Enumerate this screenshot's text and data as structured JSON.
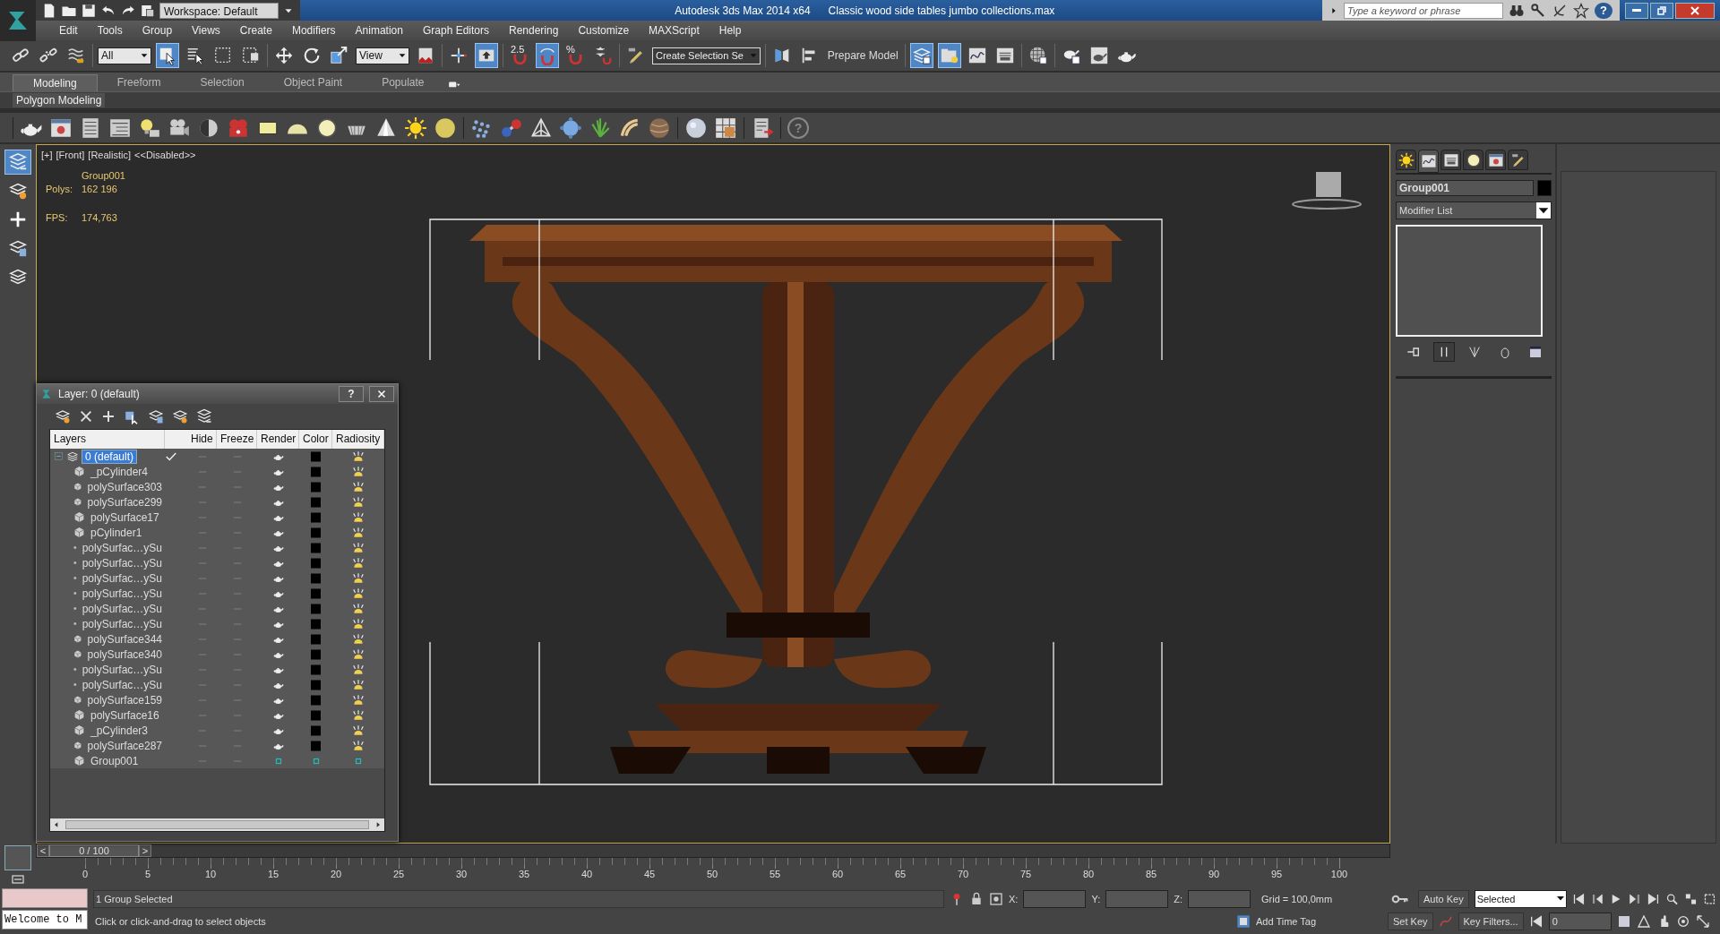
{
  "title_bar": {
    "workspace": "Workspace: Default",
    "app_title": "Autodesk 3ds Max  2014 x64",
    "file_name": "Classic wood side tables  jumbo collections.max",
    "search": {
      "placeholder": "Type a keyword or phrase"
    },
    "help": "?"
  },
  "menu": [
    "Edit",
    "Tools",
    "Group",
    "Views",
    "Create",
    "Modifiers",
    "Animation",
    "Graph Editors",
    "Rendering",
    "Customize",
    "MAXScript",
    "Help"
  ],
  "main_toolbar": [
    {
      "kind": "tool",
      "active": false
    },
    {
      "kind": "tool",
      "active": false
    },
    {
      "kind": "tool",
      "active": false
    },
    {
      "kind": "sep"
    },
    {
      "kind": "dropdown",
      "value": "All"
    },
    {
      "kind": "tool",
      "active": true
    },
    {
      "kind": "tool",
      "active": false
    },
    {
      "kind": "tool",
      "active": false
    },
    {
      "kind": "tool",
      "active": false
    },
    {
      "kind": "sep"
    },
    {
      "kind": "tool",
      "active": false
    },
    {
      "kind": "tool",
      "active": false
    },
    {
      "kind": "tool",
      "active": false
    },
    {
      "kind": "dropdown",
      "value": "View"
    },
    {
      "kind": "tool",
      "active": false
    },
    {
      "kind": "sep"
    },
    {
      "kind": "tool",
      "active": false
    },
    {
      "kind": "tool",
      "active": true
    },
    {
      "kind": "sep"
    },
    {
      "kind": "tool",
      "active": false,
      "text": "2.5"
    },
    {
      "kind": "tool",
      "active": true
    },
    {
      "kind": "tool",
      "active": false,
      "text": "%"
    },
    {
      "kind": "tool",
      "active": false
    },
    {
      "kind": "sep"
    },
    {
      "kind": "tool",
      "active": false
    },
    {
      "kind": "dropdown",
      "value": "Create Selection Se"
    },
    {
      "kind": "sep"
    },
    {
      "kind": "tool",
      "active": false
    },
    {
      "kind": "tool",
      "active": false
    },
    {
      "kind": "button",
      "label": "Prepare Model"
    },
    {
      "kind": "sep"
    },
    {
      "kind": "tool",
      "active": true
    },
    {
      "kind": "tool",
      "active": true
    },
    {
      "kind": "tool",
      "active": false
    },
    {
      "kind": "tool",
      "active": false
    },
    {
      "kind": "sep"
    },
    {
      "kind": "tool",
      "active": false
    },
    {
      "kind": "sep"
    },
    {
      "kind": "tool",
      "active": false
    },
    {
      "kind": "tool",
      "active": false
    },
    {
      "kind": "tool",
      "active": false
    }
  ],
  "ribbon": {
    "tabs": [
      {
        "label": "Modeling",
        "selected": true
      },
      {
        "label": "Freeform",
        "selected": false
      },
      {
        "label": "Selection",
        "selected": false
      },
      {
        "label": "Object Paint",
        "selected": false
      },
      {
        "label": "Populate",
        "selected": false
      }
    ],
    "panel": "Polygon Modeling"
  },
  "object_toolbar": {
    "help": "?"
  },
  "left_tools": [
    {
      "active": true
    },
    {
      "active": false
    },
    {
      "active": false
    },
    {
      "active": false
    },
    {
      "active": false
    }
  ],
  "viewport": {
    "label_parts": [
      "[+]",
      "[Front]",
      "[Realistic]",
      "<<Disabled>>"
    ],
    "stats": {
      "object": "Group001",
      "polys_label": "Polys:",
      "polys": "162 196",
      "fps_label": "FPS:",
      "fps": "174,763"
    },
    "scene": {
      "kind": "picture"
    }
  },
  "layer_dialog": {
    "title": "Layer: 0 (default)",
    "help": "?",
    "columns": [
      "Layers",
      "Hide",
      "Freeze",
      "Render",
      "Color",
      "Radiosity"
    ],
    "layers": [
      {
        "name": "0 (default)",
        "selected": true,
        "current": true,
        "expanded": true,
        "children": [
          {
            "name": "_pCylinder4",
            "by_layer": false
          },
          {
            "name": "polySurface303",
            "by_layer": false
          },
          {
            "name": "polySurface299",
            "by_layer": false
          },
          {
            "name": "polySurface17",
            "by_layer": false
          },
          {
            "name": "pCylinder1",
            "by_layer": false
          },
          {
            "name": "polySurfac…ySu",
            "by_layer": false
          },
          {
            "name": "polySurfac…ySu",
            "by_layer": false
          },
          {
            "name": "polySurfac…ySu",
            "by_layer": false
          },
          {
            "name": "polySurfac…ySu",
            "by_layer": false
          },
          {
            "name": "polySurfac…ySu",
            "by_layer": false
          },
          {
            "name": "polySurfac…ySu",
            "by_layer": false
          },
          {
            "name": "polySurface344",
            "by_layer": false
          },
          {
            "name": "polySurface340",
            "by_layer": false
          },
          {
            "name": "polySurfac…ySu",
            "by_layer": false
          },
          {
            "name": "polySurfac…ySu",
            "by_layer": false
          },
          {
            "name": "polySurface159",
            "by_layer": false
          },
          {
            "name": "polySurface16",
            "by_layer": false
          },
          {
            "name": "_pCylinder3",
            "by_layer": false
          },
          {
            "name": "polySurface287",
            "by_layer": false
          },
          {
            "name": "Group001",
            "by_layer": true
          }
        ]
      }
    ]
  },
  "command_panel": {
    "tabs": [
      {
        "selected": false
      },
      {
        "selected": true
      },
      {
        "selected": false
      },
      {
        "selected": false
      },
      {
        "selected": false
      },
      {
        "selected": false
      }
    ],
    "object_name": "Group001",
    "modifier_list": "Modifier List",
    "stack_tools": [
      {
        "active": false
      },
      {
        "active": true
      },
      {
        "active": false
      },
      {
        "active": false
      },
      {
        "active": false
      }
    ]
  },
  "time_slider": {
    "position": "0 / 100",
    "prev": "<",
    "next": ">"
  },
  "track_bar": {
    "ticks": [
      "0",
      "5",
      "10",
      "15",
      "20",
      "25",
      "30",
      "35",
      "40",
      "45",
      "50",
      "55",
      "60",
      "65",
      "70",
      "75",
      "80",
      "85",
      "90",
      "95",
      "100"
    ]
  },
  "status_bar": {
    "listener": "Welcome to M",
    "selection": "1 Group Selected",
    "prompt": "Click or click-and-drag to select objects",
    "x_label": "X:",
    "y_label": "Y:",
    "z_label": "Z:",
    "grid": "Grid = 100,0mm",
    "add_time_tag": "Add Time Tag",
    "auto_key": "Auto Key",
    "set_key": "Set Key",
    "key_mode": "Selected",
    "key_filters": "Key Filters...",
    "frame": "0"
  }
}
